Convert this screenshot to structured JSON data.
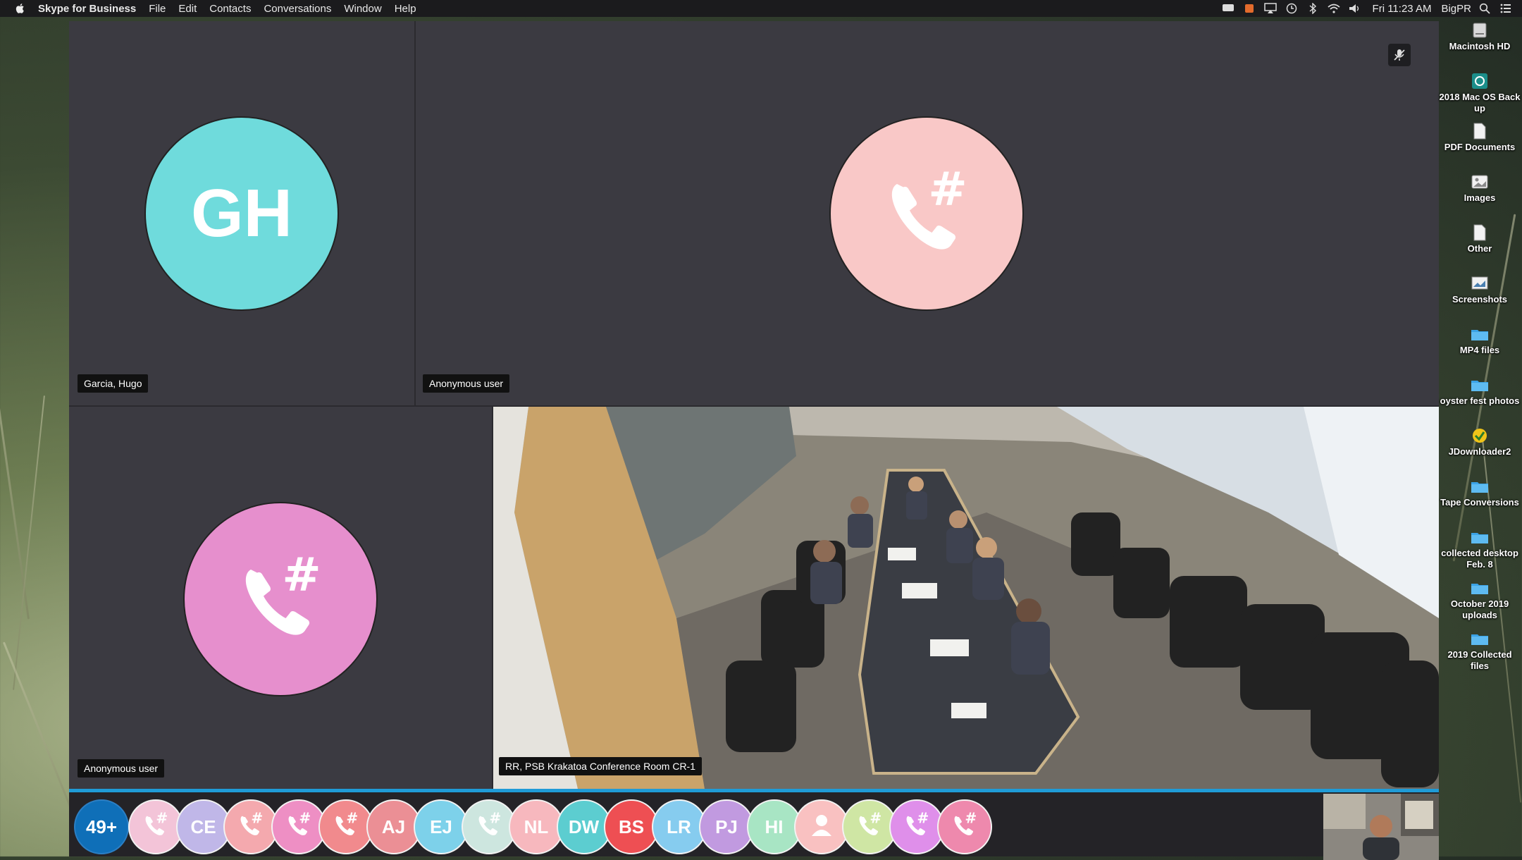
{
  "menubar": {
    "app_name": "Skype for Business",
    "menus": [
      "File",
      "Edit",
      "Contacts",
      "Conversations",
      "Window",
      "Help"
    ],
    "clock": "Fri 11:23 AM",
    "user": "BigPR"
  },
  "call": {
    "tiles": [
      {
        "initials": "GH",
        "name": "Garcia, Hugo",
        "color": "#6fdbdc"
      },
      {
        "name": "Anonymous user",
        "color": "#f9c8c7"
      },
      {
        "name": "Anonymous user",
        "color": "#e68fcd"
      },
      {
        "name": "RR, PSB Krakatoa Conference Room CR-1"
      }
    ]
  },
  "strip": {
    "count_label": "49+",
    "participants": [
      {
        "type": "phone",
        "color": "#f3c4d8"
      },
      {
        "initials": "CE",
        "color": "#c0b7e8"
      },
      {
        "type": "phone",
        "color": "#f4a9ae"
      },
      {
        "type": "phone",
        "color": "#ee8fc4"
      },
      {
        "type": "phone",
        "color": "#f18a8d"
      },
      {
        "initials": "AJ",
        "color": "#eb8f95"
      },
      {
        "initials": "EJ",
        "color": "#7dd1ea"
      },
      {
        "type": "phone",
        "color": "#cde6df"
      },
      {
        "initials": "NL",
        "color": "#f7b8be"
      },
      {
        "initials": "DW",
        "color": "#5ccdd0"
      },
      {
        "initials": "BS",
        "color": "#ee4f53"
      },
      {
        "initials": "LR",
        "color": "#86ccef"
      },
      {
        "initials": "PJ",
        "color": "#c19ae0"
      },
      {
        "initials": "HI",
        "color": "#a8e5c4"
      },
      {
        "type": "person",
        "color": "#f9c1c1"
      },
      {
        "type": "phone",
        "color": "#cfe6a4"
      },
      {
        "type": "phone",
        "color": "#df8fea"
      },
      {
        "type": "phone",
        "color": "#ee89ad"
      }
    ]
  },
  "desktop": [
    {
      "label": "Macintosh HD",
      "icon": "drive-icon"
    },
    {
      "label": "2018 Mac OS Back up",
      "icon": "backup-drive-icon"
    },
    {
      "label": "PDF Documents",
      "icon": "document-icon"
    },
    {
      "label": "Images",
      "icon": "image-icon"
    },
    {
      "label": "Other",
      "icon": "document-icon"
    },
    {
      "label": "Screenshots",
      "icon": "screenshot-icon"
    },
    {
      "label": "MP4 files",
      "icon": "folder-icon"
    },
    {
      "label": "oyster fest photos",
      "icon": "folder-icon"
    },
    {
      "label": "JDownloader2",
      "icon": "app-icon"
    },
    {
      "label": "Tape Conversions",
      "icon": "folder-icon"
    },
    {
      "label": "collected desktop Feb. 8",
      "icon": "folder-icon"
    },
    {
      "label": "October 2019 uploads",
      "icon": "folder-icon"
    },
    {
      "label": "2019 Collected files",
      "icon": "folder-icon"
    }
  ]
}
